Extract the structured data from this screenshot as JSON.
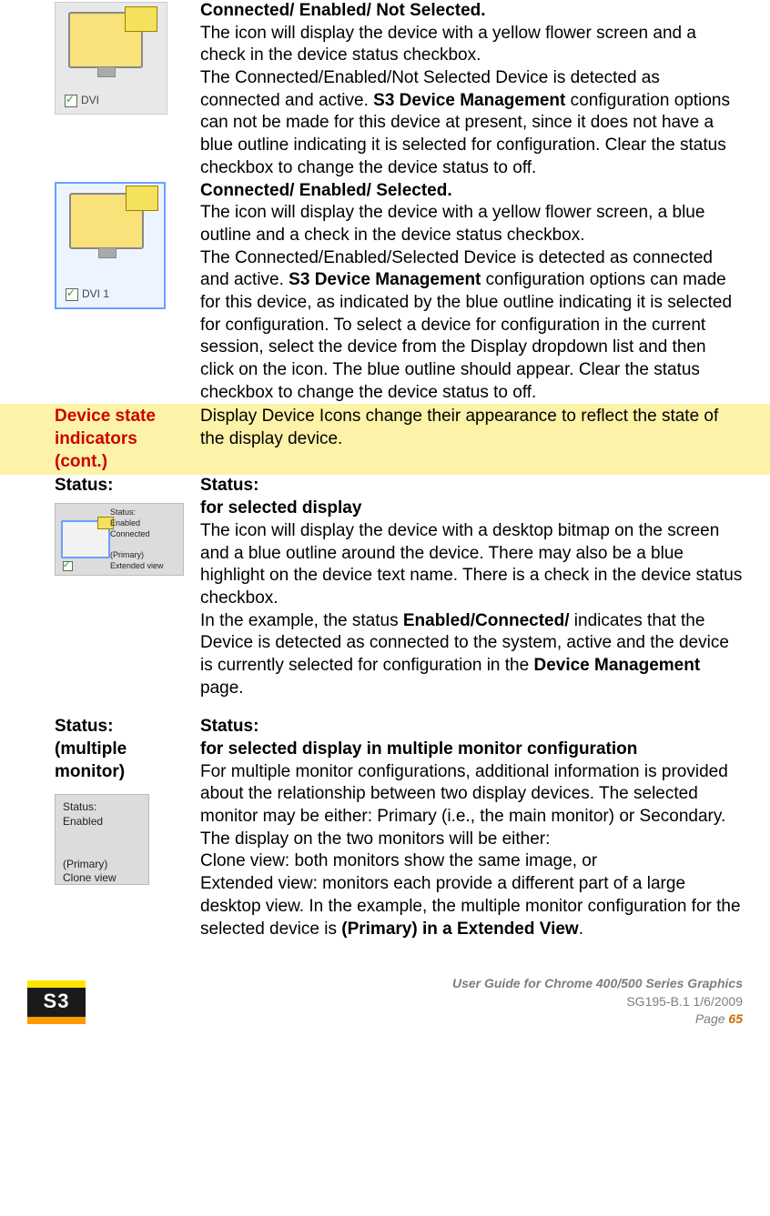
{
  "rows": [
    {
      "left_label": "",
      "icon1_caption": "DVI",
      "title1": "Connected/ Enabled/ Not Selected.",
      "para1a": "The icon will display the device with a yellow flower screen and a check in the device status checkbox.",
      "para1b_pre": "The Connected/Enabled/Not Selected Device is detected as connected and active. ",
      "para1b_bold": "S3 Device Management",
      "para1b_post": " configuration options can not be made for this device at present, since it does not have a blue outline indicating it is selected for configuration. Clear the status checkbox to change the device status to off.",
      "icon2_caption": "DVI 1",
      "title2": "Connected/ Enabled/ Selected.",
      "para2a": "The icon will display the device with a yellow flower screen, a blue outline and a check in the device status checkbox.",
      "para2b_pre": "The Connected/Enabled/Selected Device is detected as connected and active. ",
      "para2b_bold": "S3 Device Management",
      "para2b_post": " configuration options can made for this device, as indicated by the blue outline indicating it is selected for configuration. To select a device for configuration in the current session, select the device from the Display dropdown list and then click on the icon. The blue outline should appear. Clear the status checkbox to change the device status to off."
    }
  ],
  "section_header": {
    "left1": "Device state",
    "left2": "indicators",
    "left3": "(cont.)",
    "right": "Display Device Icons change their appearance to reflect the state of the display device."
  },
  "status1": {
    "left_title": "Status:",
    "mini_lines": "Status:\nEnabled\nConnected\n\n(Primary)\nExtended view",
    "right_title": "Status:",
    "right_sub": "for selected display",
    "p1": "The icon will display the device with a desktop bitmap on the screen and a blue outline around the device. There may also be a blue highlight on the device text name. There is a check in the device status checkbox.",
    "p2_pre": "In the example, the status ",
    "p2_bold1": "Enabled/Connected/",
    "p2_mid": " indicates that the Device is detected as connected to the system, active and the device is currently selected for configuration in the ",
    "p2_bold2": "Device Management",
    "p2_post": " page."
  },
  "status2": {
    "left_title": "Status:",
    "left_sub": "(multiple monitor)",
    "box_lines": "Status:\nEnabled\n\n\n(Primary)\nClone view",
    "right_title": "Status:",
    "right_sub": "for selected display in multiple monitor configuration",
    "p1": "For multiple monitor configurations, additional information is provided about the relationship between two display devices. The selected monitor may be either: Primary (i.e., the main monitor) or Secondary. The display on the two monitors will be either:",
    "p2": "Clone view: both monitors show the same image, or",
    "p3_pre": "Extended view: monitors each provide a different part of a large desktop view. In the example, the multiple monitor configuration for the selected device is ",
    "p3_bold": "(Primary)  in a Extended View",
    "p3_post": "."
  },
  "footer": {
    "logo_text": "S3",
    "title": "User Guide for Chrome 400/500 Series Graphics",
    "doc": "SG195-B.1   1/6/2009",
    "page_label": "Page ",
    "page_num": "65"
  }
}
